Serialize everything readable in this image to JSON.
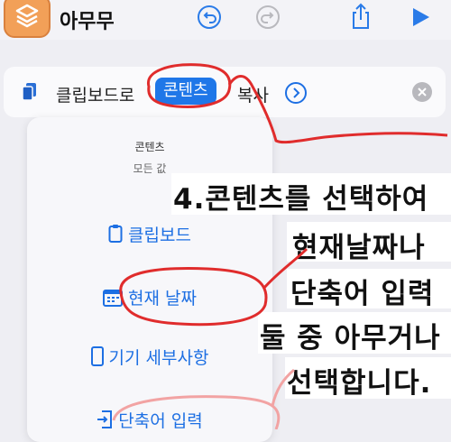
{
  "header": {
    "title": "아무무",
    "icons": [
      "shortcuts-app-icon",
      "undo-icon",
      "redo-icon",
      "share-icon",
      "play-icon"
    ]
  },
  "action": {
    "text_before": "클립보드로",
    "token": "콘텐츠",
    "text_after": "복사",
    "icons": [
      "document-icon",
      "chevron-right-icon",
      "clear-icon"
    ]
  },
  "panel": {
    "header": "콘텐츠",
    "subheader": "모든 값",
    "options": [
      {
        "label": "클립보드",
        "icon": "clipboard-icon"
      },
      {
        "label": "현재 날짜",
        "icon": "calendar-icon"
      },
      {
        "label": "기기 세부사항",
        "icon": "phone-icon"
      },
      {
        "label": "단축어 입력",
        "icon": "input-icon"
      }
    ]
  },
  "annotation": {
    "lines": [
      "4.콘텐츠를 선택하여",
      "현재날짜나",
      "단축어 입력",
      "둘 중 아무거나",
      "선택합니다."
    ]
  },
  "colors": {
    "accent": "#1f77e8",
    "annotation": "#e02c2c",
    "annotation_light": "#f2a3a3",
    "app_icon": "#f2a058"
  }
}
